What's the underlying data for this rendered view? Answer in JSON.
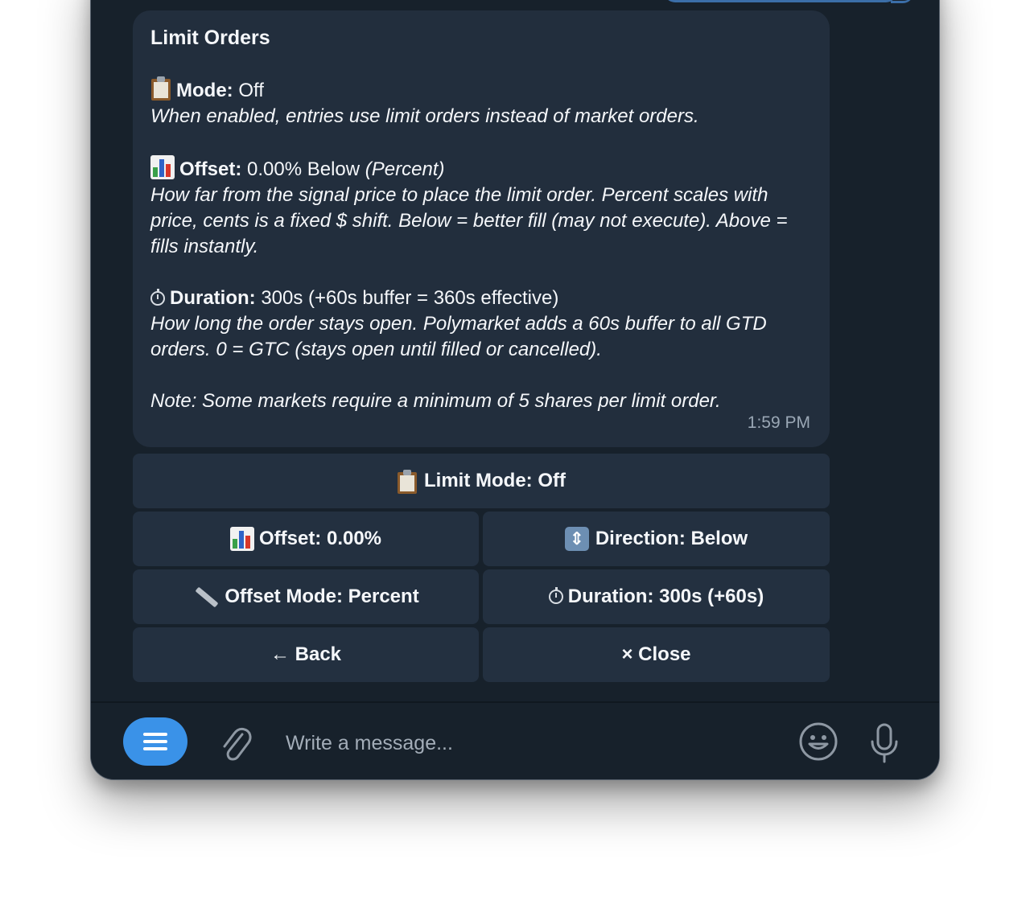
{
  "message": {
    "title": "Limit Orders",
    "mode": {
      "label": "Mode:",
      "value": " Off",
      "description": "When enabled, entries use limit orders instead of market orders."
    },
    "offset": {
      "label": "Offset:",
      "value": " 0.00% Below ",
      "unit": "(Percent)",
      "description": "How far from the signal price to place the limit order. Percent scales with price, cents is a fixed $ shift. Below = better fill (may not execute). Above = fills instantly."
    },
    "duration": {
      "label": "Duration:",
      "value": " 300s (+60s buffer = 360s effective)",
      "description": "How long the order stays open. Polymarket adds a 60s buffer to all GTD orders. 0 = GTC (stays open until filled or cancelled)."
    },
    "note": "Note: Some markets require a minimum of 5 shares per limit order.",
    "time": "1:59 PM"
  },
  "keyboard": {
    "limit_mode": "Limit Mode: Off",
    "offset": "Offset: 0.00%",
    "direction": "Direction: Below",
    "offset_mode": "Offset Mode: Percent",
    "duration": "Duration: 300s (+60s)",
    "back": "← Back",
    "close": "× Close"
  },
  "composer": {
    "placeholder": "Write a message..."
  },
  "icons": {
    "mode": "clipboard-icon",
    "offset": "bar-chart-icon",
    "duration": "stopwatch-icon",
    "direction": "up-down-arrow-icon",
    "offset_mode": "ruler-icon",
    "menu": "menu-icon",
    "attach": "paperclip-icon",
    "emoji": "smile-icon",
    "mic": "microphone-icon"
  },
  "colors": {
    "background": "#17212b",
    "bubble": "#222e3d",
    "button": "#233040",
    "accent": "#3a92e8"
  }
}
